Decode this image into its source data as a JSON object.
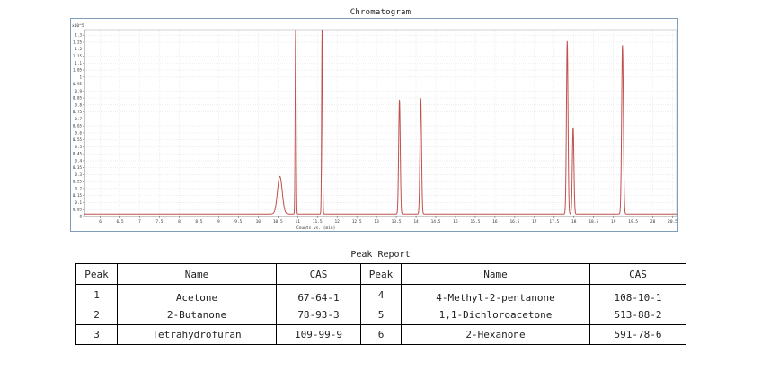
{
  "chart_data": {
    "type": "line",
    "title": "Chromatogram",
    "ylabel": "x10^5",
    "xlabel": "Counts vs. (min)",
    "xlim": [
      5.6,
      20.6
    ],
    "ylim": [
      0,
      1.34
    ],
    "grid": true,
    "x_ticks": [
      "6",
      "6.5",
      "7",
      "7.5",
      "8",
      "8.5",
      "9",
      "9.5",
      "10",
      "10.5",
      "11",
      "11.5",
      "12",
      "12.5",
      "13",
      "13.5",
      "14",
      "14.5",
      "15",
      "15.5",
      "16",
      "16.5",
      "17",
      "17.5",
      "18",
      "18.5",
      "19",
      "19.5",
      "20",
      "20.5"
    ],
    "y_ticks": [
      "0",
      "0.05",
      "0.1",
      "0.15",
      "0.2",
      "0.25",
      "0.3",
      "0.35",
      "0.4",
      "0.45",
      "0.5",
      "0.55",
      "0.6",
      "0.65",
      "0.7",
      "0.75",
      "0.8",
      "0.85",
      "0.9",
      "0.95",
      "1",
      "1.05",
      "1.1",
      "1.15",
      "1.2",
      "1.25",
      "1.3"
    ],
    "series": [
      {
        "color": "#c0504d",
        "peaks": [
          {
            "rt": 10.55,
            "height": 0.27,
            "width": 0.06
          },
          {
            "rt": 10.95,
            "height": 1.34,
            "width": 0.012,
            "saturated": true
          },
          {
            "rt": 11.62,
            "height": 1.34,
            "width": 0.012,
            "saturated": true
          },
          {
            "rt": 13.58,
            "height": 0.82,
            "width": 0.02
          },
          {
            "rt": 14.12,
            "height": 0.83,
            "width": 0.02
          },
          {
            "rt": 17.83,
            "height": 1.24,
            "width": 0.02
          },
          {
            "rt": 17.98,
            "height": 0.62,
            "width": 0.02
          },
          {
            "rt": 19.23,
            "height": 1.21,
            "width": 0.022
          }
        ]
      }
    ]
  },
  "report": {
    "title": "Peak Report",
    "headers": [
      "Peak",
      "Name",
      "CAS",
      "Peak",
      "Name",
      "CAS"
    ],
    "rows": [
      [
        "1",
        "Acetone",
        "67-64-1",
        "4",
        "4-Methyl-2-pentanone",
        "108-10-1"
      ],
      [
        "2",
        "2-Butanone",
        "78-93-3",
        "5",
        "1,1-Dichloroacetone",
        "513-88-2"
      ],
      [
        "3",
        "Tetrahydrofuran",
        "109-99-9",
        "6",
        "2-Hexanone",
        "591-78-6"
      ]
    ]
  }
}
